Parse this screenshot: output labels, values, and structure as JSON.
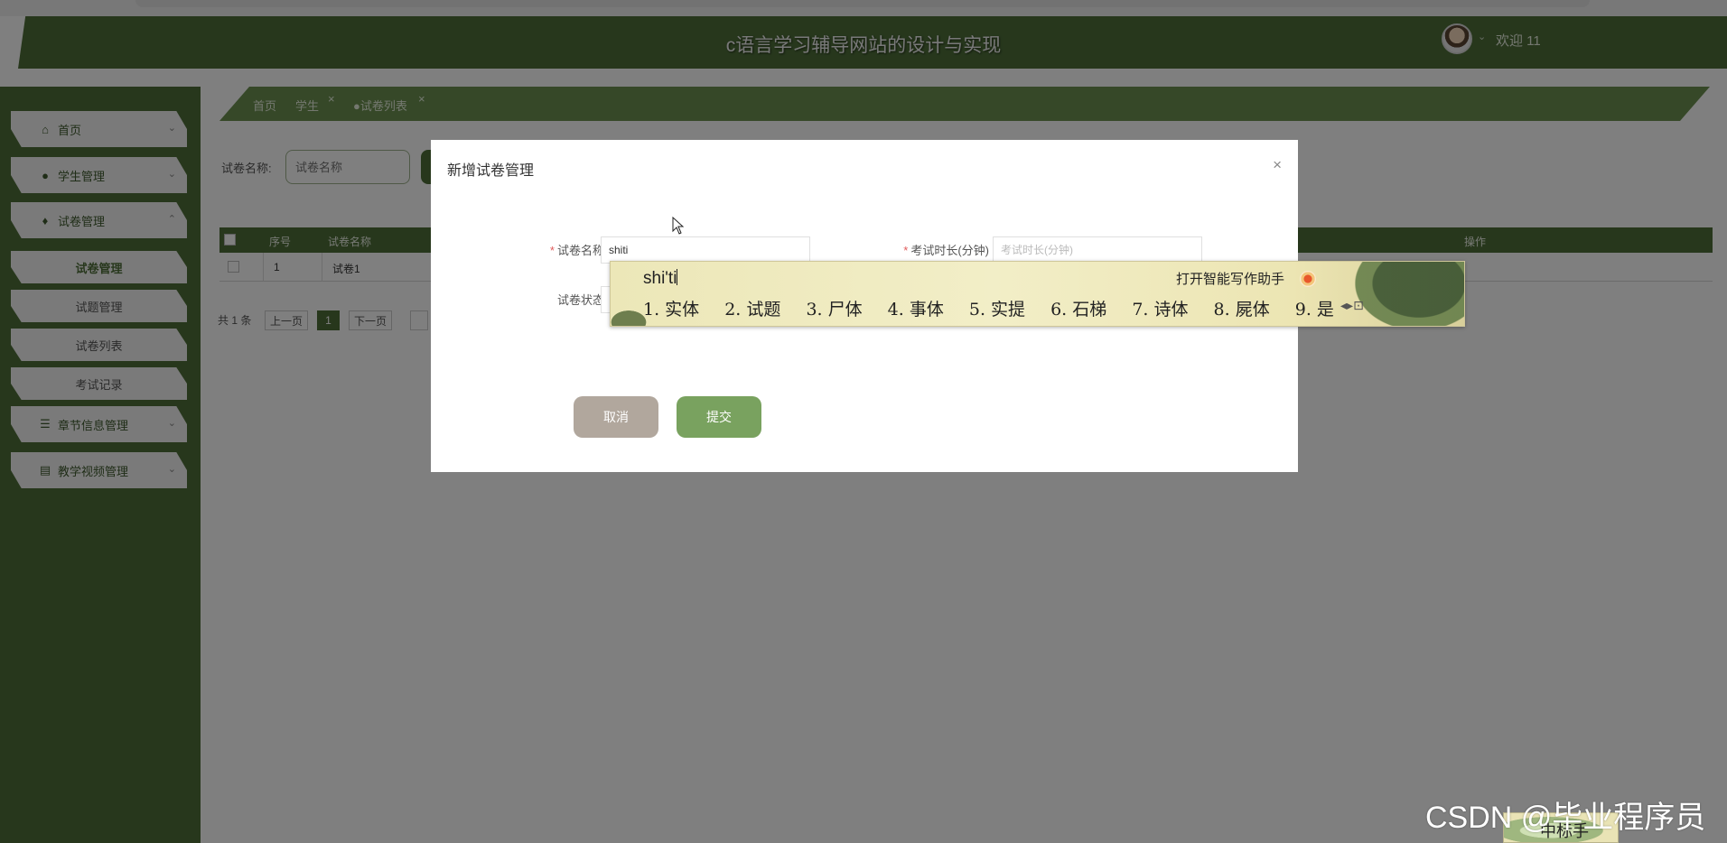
{
  "header": {
    "title": "c语言学习辅导网站的设计与实现",
    "welcome": "欢迎 11"
  },
  "sidebar": {
    "items": [
      {
        "label": "首页",
        "icon": "home-icon"
      },
      {
        "label": "学生管理",
        "icon": "user-icon"
      },
      {
        "label": "试卷管理",
        "icon": "leaf-icon"
      },
      {
        "label": "章节信息管理",
        "icon": "list-icon"
      },
      {
        "label": "教学视频管理",
        "icon": "archive-icon"
      }
    ],
    "subitems": [
      "试卷管理",
      "试题管理",
      "试卷列表",
      "考试记录"
    ]
  },
  "breadcrumb": [
    "首页",
    "学生",
    "●试卷列表"
  ],
  "search": {
    "label": "试卷名称:",
    "placeholder": "试卷名称"
  },
  "table": {
    "headers": [
      "序号",
      "试卷名称",
      "操作"
    ],
    "rows": [
      {
        "index": "1",
        "name": "试卷1"
      }
    ]
  },
  "pagination": {
    "total": "共 1 条",
    "prev": "上一页",
    "current": "1",
    "next": "下一页"
  },
  "modal": {
    "title": "新增试卷管理",
    "close": "×",
    "fields": {
      "name_label": "试卷名称",
      "name_value": "shiti",
      "duration_label": "考试时长(分钟)",
      "duration_placeholder": "考试时长(分钟)",
      "status_label": "试卷状态"
    },
    "cancel": "取消",
    "submit": "提交"
  },
  "ime": {
    "pinyin": "shi'ti",
    "assistant": "打开智能写作助手",
    "candidates": [
      "1. 实体",
      "2. 试题",
      "3. 尸体",
      "4. 事体",
      "5. 实提",
      "6. 石梯",
      "7. 诗体",
      "8. 屍体",
      "9. 是"
    ]
  },
  "watermark": {
    "text": "CSDN @毕业程序员",
    "stamp": "中标手"
  },
  "colors": {
    "primary": "#4e6f39",
    "accent": "#6c9150",
    "submit": "#79a25f",
    "cancel": "#b1a79d"
  }
}
